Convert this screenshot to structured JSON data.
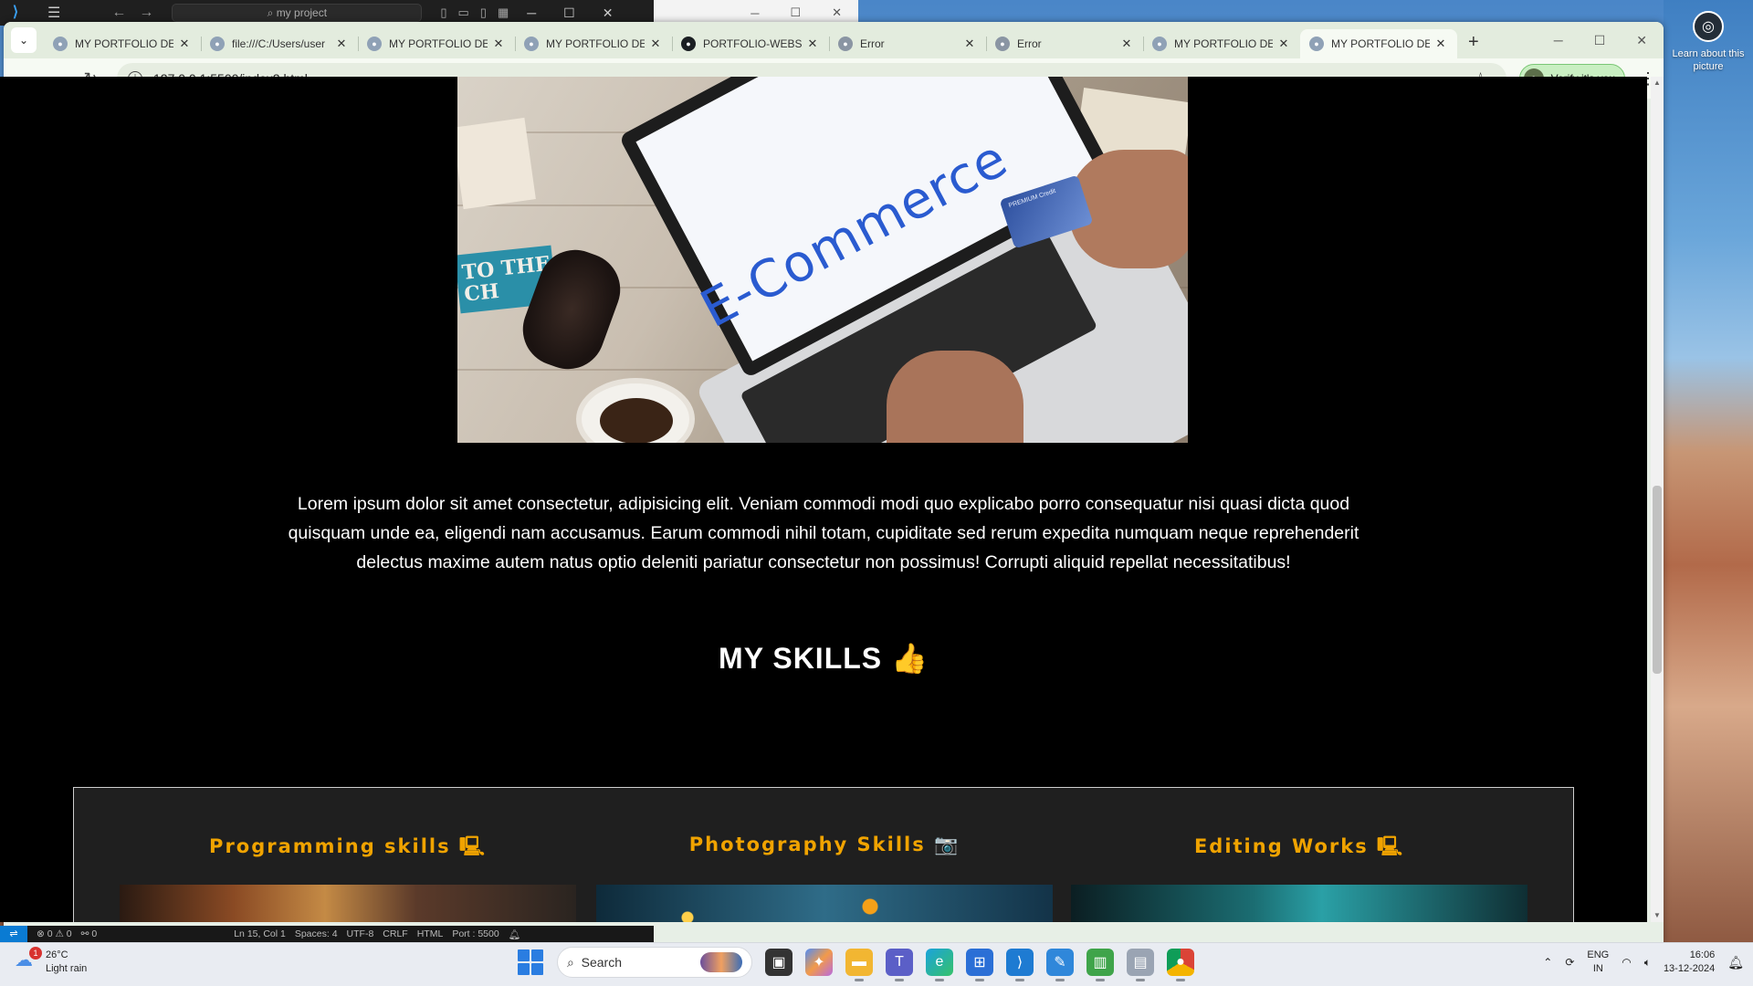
{
  "vscode": {
    "search_text": "my project",
    "status": {
      "problems": "⊗ 0 ⚠ 0",
      "ports": "⚯ 0",
      "position": "Ln 15, Col 1",
      "spaces": "Spaces: 4",
      "encoding": "UTF-8",
      "eol": "CRLF",
      "language": "HTML",
      "port": "Port : 5500"
    }
  },
  "browser": {
    "tabs": [
      {
        "title": "MY PORTFOLIO DE",
        "icon": "portfolio-favicon"
      },
      {
        "title": "file:///C:/Users/user",
        "icon": "file-favicon"
      },
      {
        "title": "MY PORTFOLIO DE",
        "icon": "portfolio-favicon"
      },
      {
        "title": "MY PORTFOLIO DE",
        "icon": "portfolio-favicon"
      },
      {
        "title": "PORTFOLIO-WEBSI",
        "icon": "github-icon"
      },
      {
        "title": "Error",
        "icon": "error-favicon"
      },
      {
        "title": "Error",
        "icon": "error-favicon"
      },
      {
        "title": "MY PORTFOLIO DE",
        "icon": "portfolio-favicon"
      },
      {
        "title": "MY PORTFOLIO DE",
        "icon": "portfolio-favicon",
        "active": true
      }
    ],
    "url": "127.0.0.1:5500/index2.html",
    "verify_label": "Verify it's you"
  },
  "page": {
    "hero_image_text": "E-Commerce",
    "sign_text": "TO THE\nCH",
    "card_text": "PREMIUM Credit",
    "about_text": "Lorem ipsum dolor sit amet consectetur, adipisicing elit. Veniam commodi modi quo explicabo porro consequatur nisi quasi dicta quod quisquam unde ea, eligendi nam accusamus. Earum commodi nihil totam, cupiditate sed rerum expedita numquam neque reprehenderit delectus maxime autem natus optio deleniti pariatur consectetur non possimus! Corrupti aliquid repellat necessitatibus!",
    "skills_heading": "MY SKILLS",
    "skills": [
      {
        "title": "Programming skills",
        "icon": "laptop-icon"
      },
      {
        "title": "Photography Skills",
        "icon": "camera-icon"
      },
      {
        "title": "Editing Works",
        "icon": "laptop-icon"
      }
    ]
  },
  "desktop": {
    "learn_label": "Learn about this picture"
  },
  "taskbar": {
    "weather_temp": "26°C",
    "weather_desc": "Light rain",
    "weather_badge": "1",
    "search_placeholder": "Search",
    "lang_top": "ENG",
    "lang_bottom": "IN",
    "time": "16:06",
    "date": "13-12-2024"
  },
  "colors": {
    "skill_title": "#f0a300",
    "page_bg": "#000000",
    "skills_box_bg": "#1f1f1f"
  }
}
